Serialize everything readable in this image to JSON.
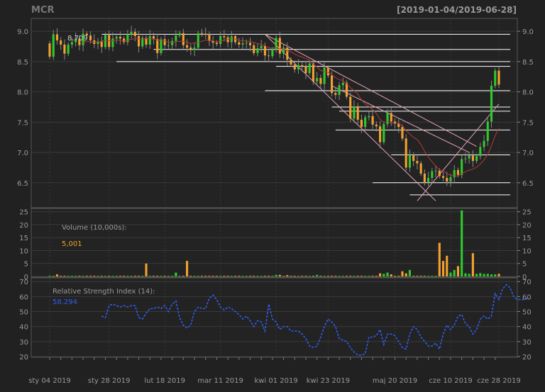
{
  "title": "MCR",
  "date_range": "[2019-01-04/2019-06-28]",
  "colors": {
    "background": "#212121",
    "panel": "#232323",
    "up": "#2ec92e",
    "down": "#f2a12e",
    "ma": "#b33a3a",
    "rsi": "#2f5ef0",
    "line": "#ffffff",
    "trend": "#e6a3b5",
    "grid": "#3a3a3a",
    "text": "#999999"
  },
  "x_axis": {
    "ticks": [
      {
        "label": "sty 04 2019",
        "idx": 0
      },
      {
        "label": "sty 28 2019",
        "idx": 16
      },
      {
        "label": "lut 18 2019",
        "idx": 31
      },
      {
        "label": "mar 11 2019",
        "idx": 46
      },
      {
        "label": "kwi 01 2019",
        "idx": 61
      },
      {
        "label": "kwi 23 2019",
        "idx": 75
      },
      {
        "label": "maj 20 2019",
        "idx": 93
      },
      {
        "label": "cze 10 2019",
        "idx": 108
      },
      {
        "label": "cze 28 2019",
        "idx": 121
      }
    ]
  },
  "chart_data": [
    {
      "type": "candlestick",
      "panel": "price",
      "last_value_label": "8.709",
      "ylim": [
        6.1,
        9.2
      ],
      "yticks": [
        "6.5",
        "7.0",
        "7.5",
        "8.0",
        "8.5",
        "9.0"
      ],
      "n_days": 122,
      "close": [
        8.58,
        8.95,
        8.85,
        8.78,
        8.63,
        8.78,
        8.82,
        8.88,
        8.77,
        8.96,
        8.93,
        8.85,
        8.79,
        8.83,
        8.74,
        8.94,
        8.74,
        8.88,
        8.91,
        8.88,
        8.82,
        8.95,
        8.99,
        8.92,
        8.75,
        8.89,
        8.78,
        8.92,
        8.87,
        8.64,
        8.87,
        8.77,
        8.77,
        8.84,
        8.93,
        8.97,
        8.77,
        8.73,
        8.69,
        8.73,
        8.97,
        8.96,
        8.94,
        8.84,
        8.81,
        8.79,
        8.92,
        8.9,
        8.82,
        8.92,
        8.82,
        8.78,
        8.8,
        8.81,
        8.77,
        8.64,
        8.72,
        8.76,
        8.6,
        8.59,
        8.7,
        8.89,
        8.63,
        8.73,
        8.53,
        8.45,
        8.37,
        8.44,
        8.42,
        8.31,
        8.47,
        8.17,
        8.23,
        8.13,
        8.4,
        8.27,
        7.98,
        7.95,
        8.11,
        8.15,
        7.92,
        7.56,
        7.76,
        7.54,
        7.42,
        7.58,
        7.6,
        7.46,
        7.43,
        7.17,
        7.47,
        7.65,
        7.51,
        7.48,
        7.42,
        7.23,
        6.75,
        6.95,
        6.86,
        6.82,
        6.65,
        6.51,
        6.58,
        6.69,
        6.7,
        6.61,
        6.58,
        6.52,
        6.59,
        6.71,
        6.63,
        6.89,
        6.9,
        6.95,
        6.86,
        6.94,
        7.09,
        7.19,
        7.51,
        8.1,
        8.35,
        8.12
      ],
      "ma_label": "moving average",
      "rsi_label": "RSI",
      "horizontal_levels": [
        {
          "price": 8.95,
          "from_idx": 14,
          "to_idx": 121
        },
        {
          "price": 8.7,
          "from_idx": 28,
          "to_idx": 121
        },
        {
          "price": 8.5,
          "from_idx": 18,
          "to_idx": 121
        },
        {
          "price": 8.42,
          "from_idx": 61,
          "to_idx": 121
        },
        {
          "price": 8.02,
          "from_idx": 58,
          "to_idx": 121
        },
        {
          "price": 7.75,
          "from_idx": 76,
          "to_idx": 121
        },
        {
          "price": 7.68,
          "from_idx": 78,
          "to_idx": 121
        },
        {
          "price": 7.37,
          "from_idx": 77,
          "to_idx": 121
        },
        {
          "price": 6.96,
          "from_idx": 92,
          "to_idx": 121
        },
        {
          "price": 6.5,
          "from_idx": 87,
          "to_idx": 121
        },
        {
          "price": 6.3,
          "from_idx": 97,
          "to_idx": 121
        }
      ],
      "trend_lines": [
        {
          "x1": 58,
          "y1": 8.95,
          "x2": 104,
          "y2": 6.2
        },
        {
          "x1": 58,
          "y1": 8.95,
          "x2": 115,
          "y2": 7.1
        },
        {
          "x1": 99,
          "y1": 6.2,
          "x2": 121,
          "y2": 7.8
        },
        {
          "x1": 76,
          "y1": 8.1,
          "x2": 113,
          "y2": 7.0
        }
      ]
    },
    {
      "type": "bar",
      "panel": "volume",
      "label": "Volume (10,000s):",
      "last_value_label": "5,001",
      "ylim": [
        0,
        26
      ],
      "yticks": [
        "0",
        "5",
        "10",
        "15",
        "20",
        "25"
      ],
      "highlights": [
        {
          "idx": 2,
          "v": 0.8
        },
        {
          "idx": 26,
          "v": 5.0
        },
        {
          "idx": 34,
          "v": 1.5
        },
        {
          "idx": 37,
          "v": 6.0
        },
        {
          "idx": 61,
          "v": 0.6
        },
        {
          "idx": 62,
          "v": 0.6
        },
        {
          "idx": 64,
          "v": 0.5
        },
        {
          "idx": 72,
          "v": 0.6
        },
        {
          "idx": 89,
          "v": 1.2
        },
        {
          "idx": 90,
          "v": 1.0
        },
        {
          "idx": 91,
          "v": 1.5
        },
        {
          "idx": 92,
          "v": 0.8
        },
        {
          "idx": 95,
          "v": 2.0
        },
        {
          "idx": 96,
          "v": 1.2
        },
        {
          "idx": 97,
          "v": 2.5
        },
        {
          "idx": 105,
          "v": 13.0
        },
        {
          "idx": 106,
          "v": 6.0
        },
        {
          "idx": 107,
          "v": 8.0
        },
        {
          "idx": 108,
          "v": 1.5
        },
        {
          "idx": 109,
          "v": 2.5
        },
        {
          "idx": 110,
          "v": 4.0
        },
        {
          "idx": 111,
          "v": 25.5
        },
        {
          "idx": 112,
          "v": 1.2
        },
        {
          "idx": 113,
          "v": 1.0
        },
        {
          "idx": 114,
          "v": 9.0
        },
        {
          "idx": 115,
          "v": 1.0
        },
        {
          "idx": 116,
          "v": 1.3
        },
        {
          "idx": 117,
          "v": 1.0
        },
        {
          "idx": 118,
          "v": 1.0
        },
        {
          "idx": 119,
          "v": 0.8
        },
        {
          "idx": 120,
          "v": 0.8
        },
        {
          "idx": 121,
          "v": 1.0
        }
      ]
    },
    {
      "type": "line",
      "panel": "rsi",
      "label": "Relative Strength Index (14):",
      "last_value_label": "58.294",
      "ylim": [
        20,
        72
      ],
      "yticks": [
        "20",
        "30",
        "40",
        "50",
        "60",
        "70"
      ],
      "start_idx": 14,
      "values": [
        47,
        46,
        54,
        55,
        54,
        53,
        54,
        53,
        54,
        54,
        46,
        45,
        49,
        52,
        52,
        53,
        52,
        54,
        50,
        55,
        57,
        46,
        41,
        39,
        41,
        50,
        53,
        52,
        52,
        59,
        61,
        58,
        53,
        51,
        53,
        52,
        50,
        48,
        45,
        47,
        44,
        40,
        44,
        43,
        37,
        55,
        45,
        43,
        38,
        40,
        40,
        37,
        37,
        37,
        35,
        32,
        27,
        26,
        27,
        33,
        40,
        45,
        43,
        40,
        32,
        31,
        30,
        26,
        23,
        21,
        21,
        22,
        33,
        33,
        34,
        38,
        28,
        35,
        35,
        34,
        30,
        26,
        25,
        35,
        40,
        38,
        33,
        30,
        27,
        27,
        29,
        25,
        35,
        41,
        38,
        41,
        47,
        48,
        42,
        40,
        35,
        38,
        45,
        47,
        45,
        47,
        62,
        58,
        65,
        68,
        66,
        60,
        58,
        58,
        58,
        59
      ]
    }
  ]
}
